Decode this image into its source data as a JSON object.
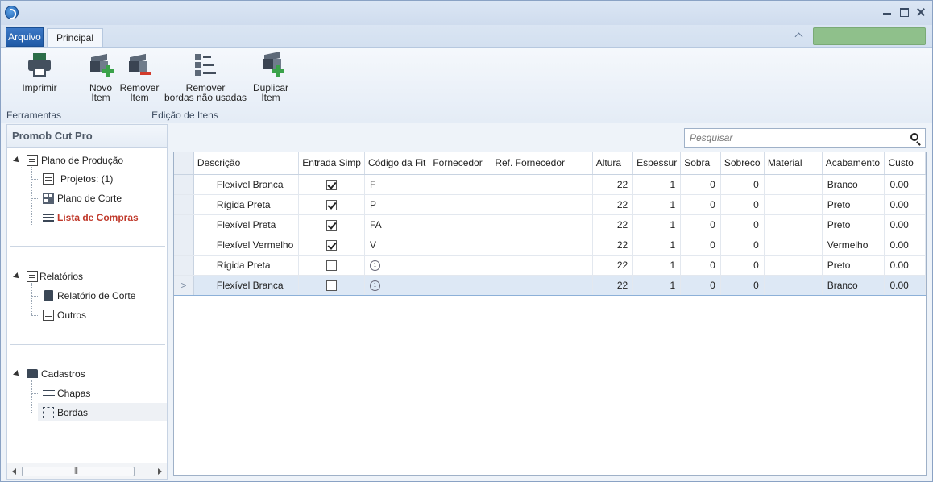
{
  "ribbon_tabs": {
    "file": "Arquivo",
    "main": "Principal"
  },
  "ribbon": {
    "print": "Imprimir",
    "group_tools": "Ferramentas",
    "new_item": [
      "Novo",
      "Item"
    ],
    "remove_item": [
      "Remover",
      "Item"
    ],
    "remove_edges": [
      "Remover",
      "bordas não usadas"
    ],
    "duplicate_item": [
      "Duplicar",
      "Item"
    ],
    "group_edit": "Edição de Itens"
  },
  "colors": {
    "status_green": "#8fc08b",
    "selected_red": "#c0392b",
    "tab_blue": "#2a66b4"
  },
  "sidebar": {
    "title": "Promob Cut Pro",
    "sections": [
      {
        "label": "Plano de Produção",
        "items": [
          "Projetos: (1)",
          "Plano de Corte",
          "Lista de Compras"
        ]
      },
      {
        "label": "Relatórios",
        "items": [
          "Relatório de Corte",
          "Outros"
        ]
      },
      {
        "label": "Cadastros",
        "items": [
          "Chapas",
          "Bordas"
        ]
      }
    ]
  },
  "search": {
    "placeholder": "Pesquisar"
  },
  "table": {
    "columns": [
      "Descrição",
      "Entrada Simp",
      "Código da Fit",
      "Fornecedor",
      "Ref. Fornecedor",
      "Altura",
      "Espessur",
      "Sobra",
      "Sobreco",
      "Material",
      "Acabamento",
      "Custo"
    ],
    "rows": [
      {
        "desc": "Flexível Branca",
        "entrada": true,
        "codigo": "F",
        "fornecedor": "",
        "ref": "",
        "altura": "22",
        "espessura": "1",
        "sobra": "0",
        "sobreco": "0",
        "material": "",
        "acabamento": "Branco",
        "custo": "0.00"
      },
      {
        "desc": "Rígida Preta",
        "entrada": true,
        "codigo": "P",
        "fornecedor": "",
        "ref": "",
        "altura": "22",
        "espessura": "1",
        "sobra": "0",
        "sobreco": "0",
        "material": "",
        "acabamento": "Preto",
        "custo": "0.00"
      },
      {
        "desc": "Flexível Preta",
        "entrada": true,
        "codigo": "FA",
        "fornecedor": "",
        "ref": "",
        "altura": "22",
        "espessura": "1",
        "sobra": "0",
        "sobreco": "0",
        "material": "",
        "acabamento": "Preto",
        "custo": "0.00"
      },
      {
        "desc": "Flexível Vermelho",
        "entrada": true,
        "codigo": "V",
        "fornecedor": "",
        "ref": "",
        "altura": "22",
        "espessura": "1",
        "sobra": "0",
        "sobreco": "0",
        "material": "",
        "acabamento": "Vermelho",
        "custo": "0.00"
      },
      {
        "desc": "Rígida Preta",
        "entrada": false,
        "codigo": "",
        "fornecedor": "",
        "ref": "",
        "altura": "22",
        "espessura": "1",
        "sobra": "0",
        "sobreco": "0",
        "material": "",
        "acabamento": "Preto",
        "custo": "0.00"
      },
      {
        "desc": "Flexível Branca",
        "entrada": false,
        "codigo": "",
        "fornecedor": "",
        "ref": "",
        "altura": "22",
        "espessura": "1",
        "sobra": "0",
        "sobreco": "0",
        "material": "",
        "acabamento": "Branco",
        "custo": "0.00"
      }
    ]
  }
}
